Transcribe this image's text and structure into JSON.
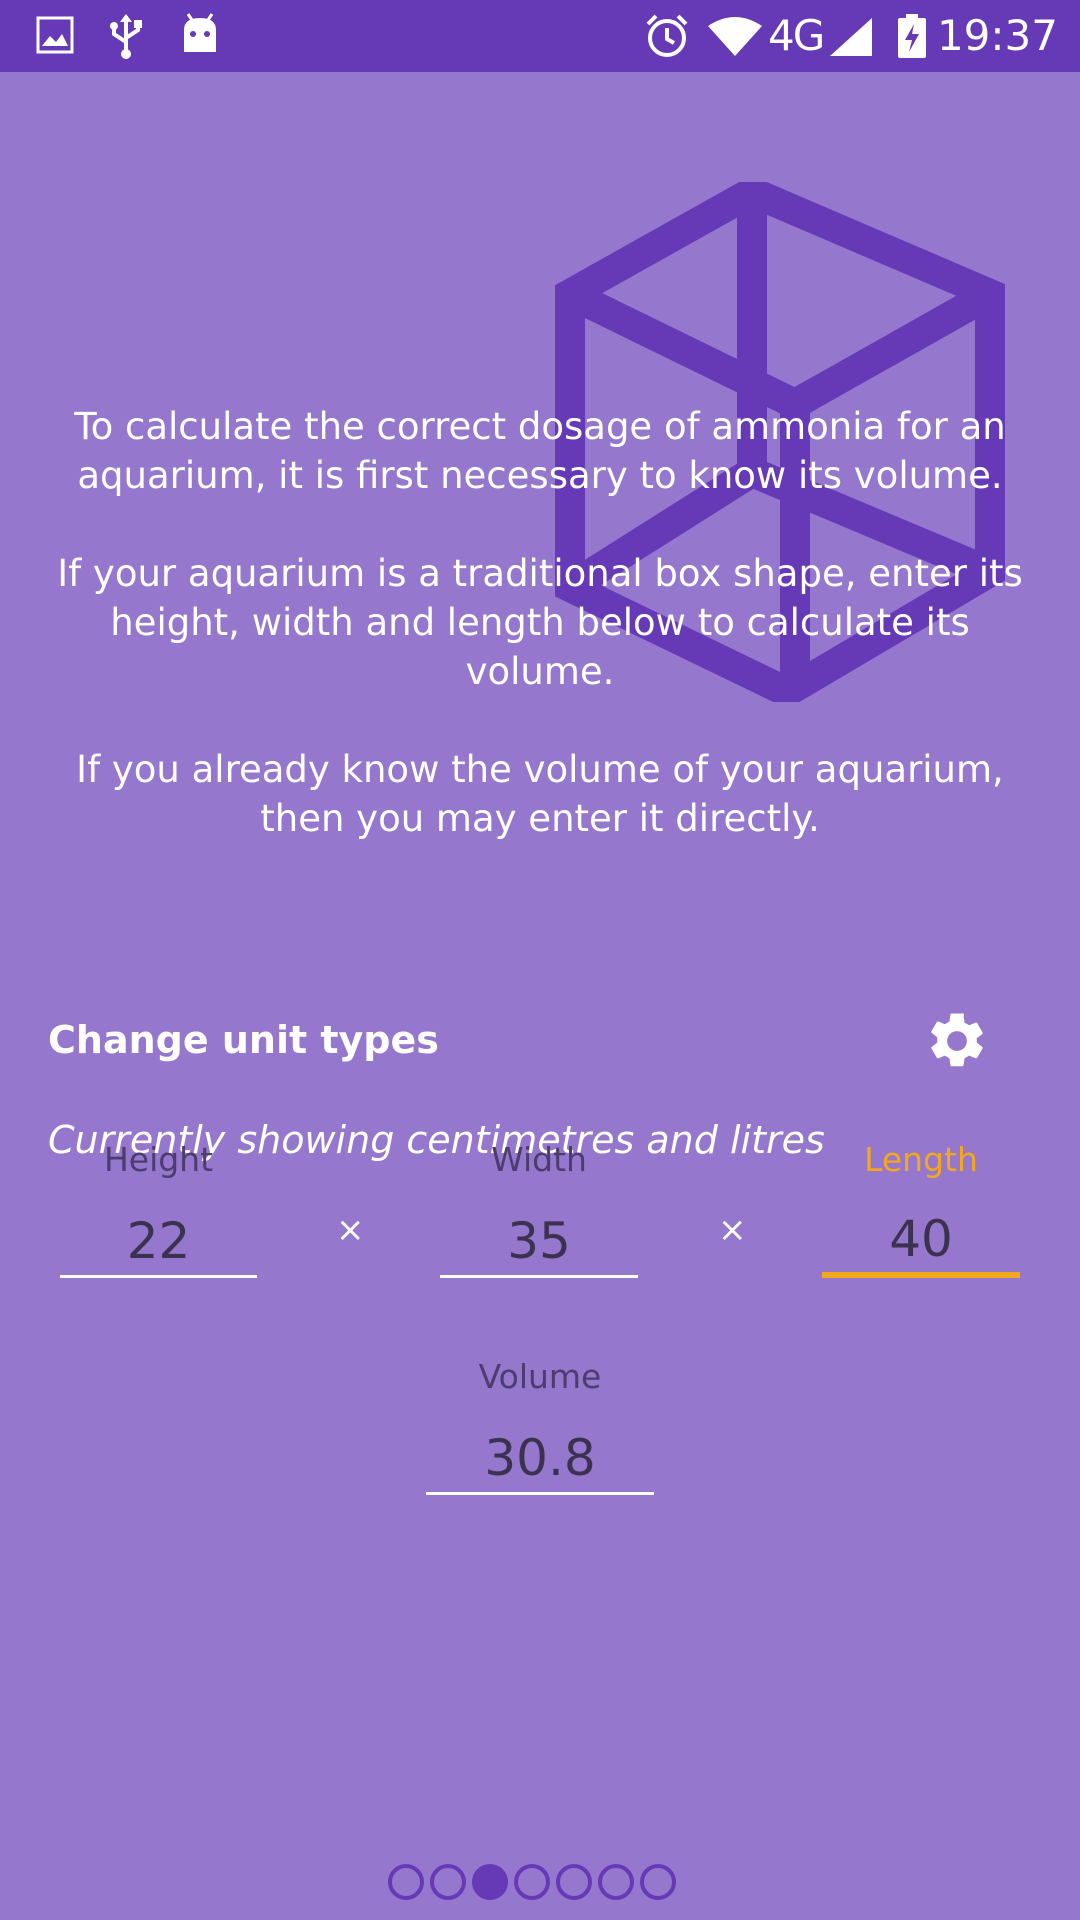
{
  "status_bar": {
    "time": "19:37",
    "network": "4G",
    "icons": [
      "gallery-icon",
      "usb-icon",
      "android-icon",
      "alarm-icon",
      "wifi-icon",
      "signal-icon",
      "battery-charging-icon"
    ]
  },
  "intro": {
    "paragraph_1": "To calculate the correct dosage of ammonia for an aquarium, it is first necessary to know its volume.",
    "paragraph_2": "If your aquarium is a traditional box shape, enter its height, width and length below to calculate its volume.",
    "paragraph_3": "If you already know the volume of your aquarium, then you may enter it directly."
  },
  "units": {
    "title": "Change unit types",
    "subtitle": "Currently showing centimetres and litres",
    "settings_icon": "gear-icon"
  },
  "dimensions": {
    "height": {
      "label": "Height",
      "value": "22"
    },
    "width": {
      "label": "Width",
      "value": "35"
    },
    "length": {
      "label": "Length",
      "value": "40"
    },
    "separator": "×"
  },
  "volume": {
    "label": "Volume",
    "value": "30.8"
  },
  "pager": {
    "total": 7,
    "active_index": 2
  },
  "colors": {
    "status_bar": "#6639b7",
    "background": "#9577cd",
    "accent": "#f2a81b",
    "illustration": "#6639b7"
  }
}
